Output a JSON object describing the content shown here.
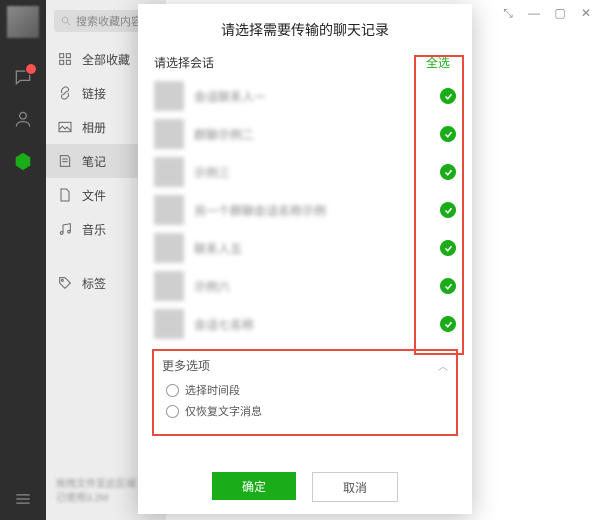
{
  "rail": {
    "chat_icon": "chat",
    "contacts_icon": "contacts",
    "fav_icon": "favorites"
  },
  "sidebar": {
    "search_placeholder": "搜索收藏内容",
    "items": [
      {
        "label": "全部收藏",
        "icon": "grid"
      },
      {
        "label": "链接",
        "icon": "link"
      },
      {
        "label": "相册",
        "icon": "image"
      },
      {
        "label": "笔记",
        "icon": "note"
      },
      {
        "label": "文件",
        "icon": "file"
      },
      {
        "label": "音乐",
        "icon": "music"
      },
      {
        "label": "标签",
        "icon": "tag"
      }
    ],
    "storage_line1": "拖拽文件至此区域",
    "storage_line2": "已使用3.2M"
  },
  "window_controls": {
    "pin": "⤡",
    "min": "—",
    "max": "▢",
    "close": "✕"
  },
  "dialog": {
    "title": "请选择需要传输的聊天记录",
    "conv_header": "请选择会话",
    "select_all": "全选",
    "conversations": [
      {
        "name": "会话联系人一"
      },
      {
        "name": "群聊示例二"
      },
      {
        "name": "示例三"
      },
      {
        "name": "另一个群聊会话名称示例"
      },
      {
        "name": "联系人五"
      },
      {
        "name": "示例六"
      },
      {
        "name": "会话七名称"
      }
    ],
    "more": {
      "header": "更多选项",
      "opt_time": "选择时间段",
      "opt_text_only": "仅恢复文字消息"
    },
    "ok": "确定",
    "cancel": "取消"
  }
}
